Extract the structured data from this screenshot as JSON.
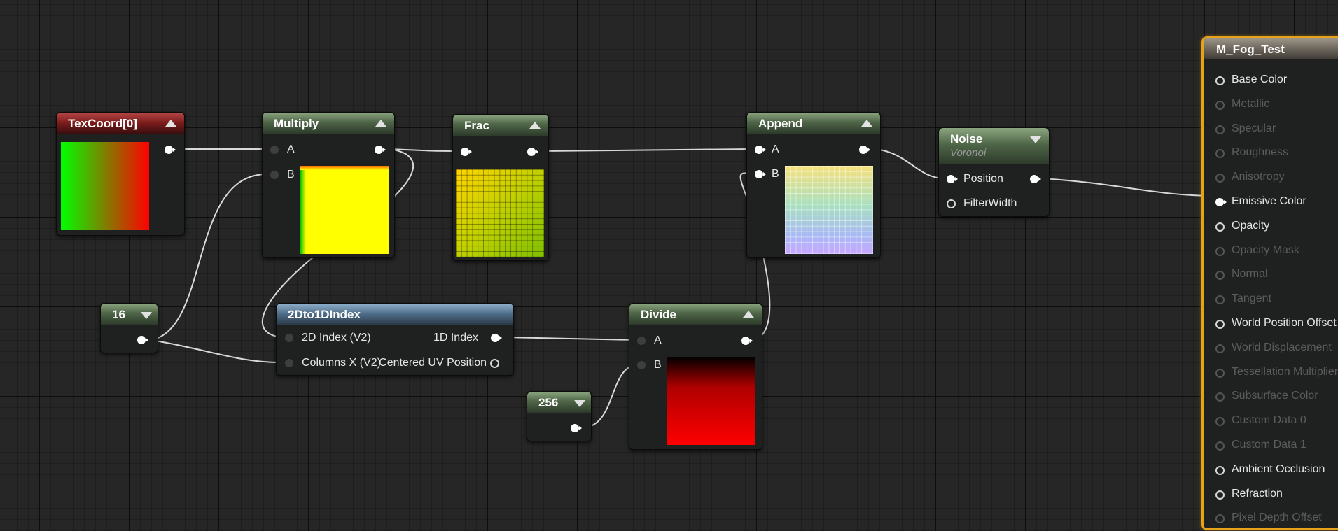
{
  "nodes": {
    "texcoord": {
      "title": "TexCoord[0]"
    },
    "multiply": {
      "title": "Multiply",
      "pins": {
        "a": "A",
        "b": "B"
      }
    },
    "frac": {
      "title": "Frac"
    },
    "append": {
      "title": "Append",
      "pins": {
        "a": "A",
        "b": "B"
      }
    },
    "noise": {
      "title": "Noise",
      "subtitle": "Voronoi",
      "pins": {
        "position": "Position",
        "filter_width": "FilterWidth"
      }
    },
    "const16": {
      "title": "16"
    },
    "index": {
      "title": "2Dto1DIndex",
      "inputs": [
        "2D Index (V2)",
        "Columns X (V2)"
      ],
      "outputs": [
        "1D Index",
        "Centered UV Position"
      ]
    },
    "divide": {
      "title": "Divide",
      "pins": {
        "a": "A",
        "b": "B"
      }
    },
    "const256": {
      "title": "256"
    }
  },
  "material": {
    "title": "M_Fog_Test",
    "inputs": [
      {
        "label": "Base Color",
        "active": true
      },
      {
        "label": "Metallic",
        "active": false
      },
      {
        "label": "Specular",
        "active": false
      },
      {
        "label": "Roughness",
        "active": false
      },
      {
        "label": "Anisotropy",
        "active": false
      },
      {
        "label": "Emissive Color",
        "active": true,
        "connected": true
      },
      {
        "label": "Opacity",
        "active": true
      },
      {
        "label": "Opacity Mask",
        "active": false
      },
      {
        "label": "Normal",
        "active": false
      },
      {
        "label": "Tangent",
        "active": false
      },
      {
        "label": "World Position Offset",
        "active": true
      },
      {
        "label": "World Displacement",
        "active": false
      },
      {
        "label": "Tessellation Multiplier",
        "active": false
      },
      {
        "label": "Subsurface Color",
        "active": false
      },
      {
        "label": "Custom Data 0",
        "active": false
      },
      {
        "label": "Custom Data 1",
        "active": false
      },
      {
        "label": "Ambient Occlusion",
        "active": true
      },
      {
        "label": "Refraction",
        "active": true
      },
      {
        "label": "Pixel Depth Offset",
        "active": false
      }
    ]
  },
  "colors": {
    "accent_selection": "#e8a21a",
    "header_green": "#4f6648",
    "header_red": "#7a1b1b",
    "header_blue": "#4d6c87",
    "wire": "#d9d9d9"
  }
}
